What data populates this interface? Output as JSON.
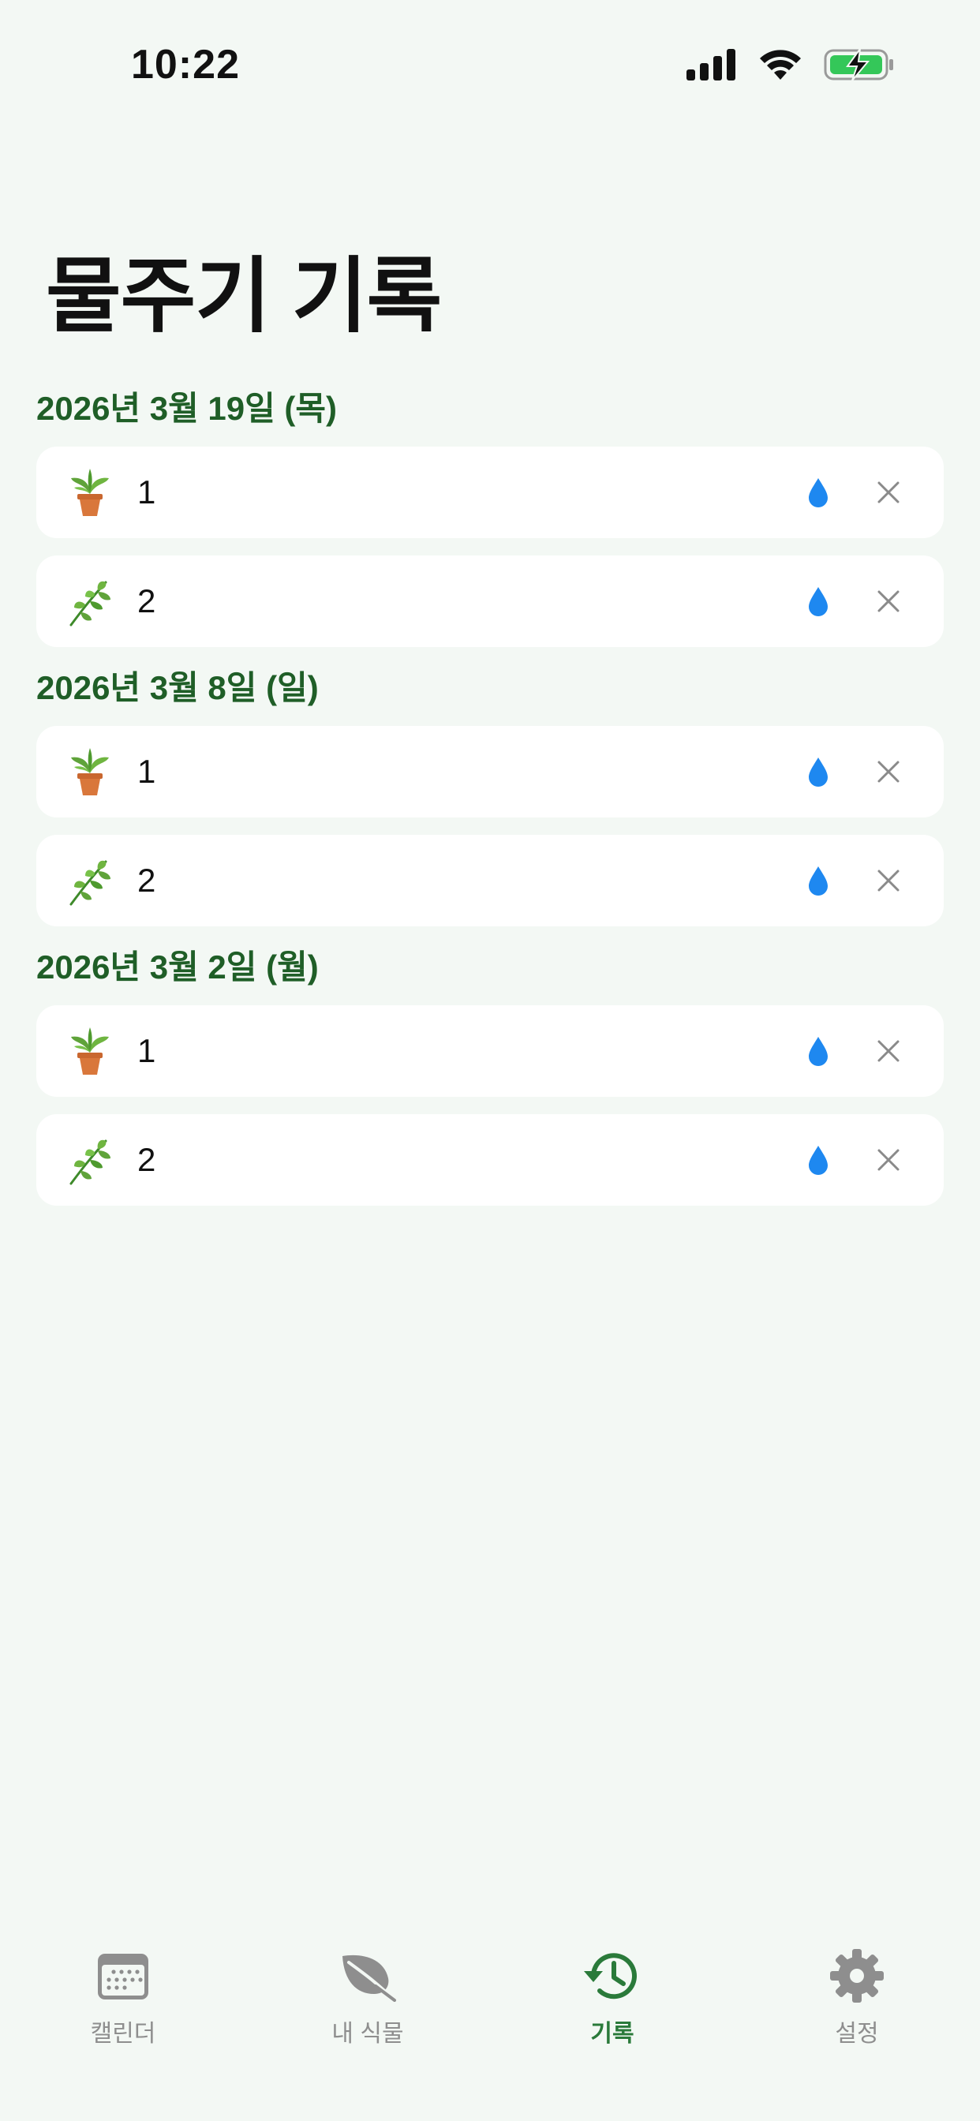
{
  "status_bar": {
    "time": "10:22"
  },
  "page": {
    "title": "물주기 기록"
  },
  "sections": [
    {
      "date": "2026년 3월 19일 (목)",
      "entries": [
        {
          "name": "1",
          "icon": "potted-plant-icon"
        },
        {
          "name": "2",
          "icon": "herb-icon"
        }
      ]
    },
    {
      "date": "2026년 3월 8일 (일)",
      "entries": [
        {
          "name": "1",
          "icon": "potted-plant-icon"
        },
        {
          "name": "2",
          "icon": "herb-icon"
        }
      ]
    },
    {
      "date": "2026년 3월 2일 (월)",
      "entries": [
        {
          "name": "1",
          "icon": "potted-plant-icon"
        },
        {
          "name": "2",
          "icon": "herb-icon"
        }
      ]
    }
  ],
  "tab_bar": {
    "tabs": [
      {
        "label": "캘린더",
        "icon": "calendar-icon",
        "active": false
      },
      {
        "label": "내 식물",
        "icon": "leaf-icon",
        "active": false
      },
      {
        "label": "기록",
        "icon": "history-icon",
        "active": true
      },
      {
        "label": "설정",
        "icon": "gear-icon",
        "active": false
      }
    ]
  },
  "colors": {
    "accent": "#2a7a3a",
    "section_header": "#1f5e27",
    "water_drop": "#1e88f0",
    "background": "#f3f8f4"
  }
}
